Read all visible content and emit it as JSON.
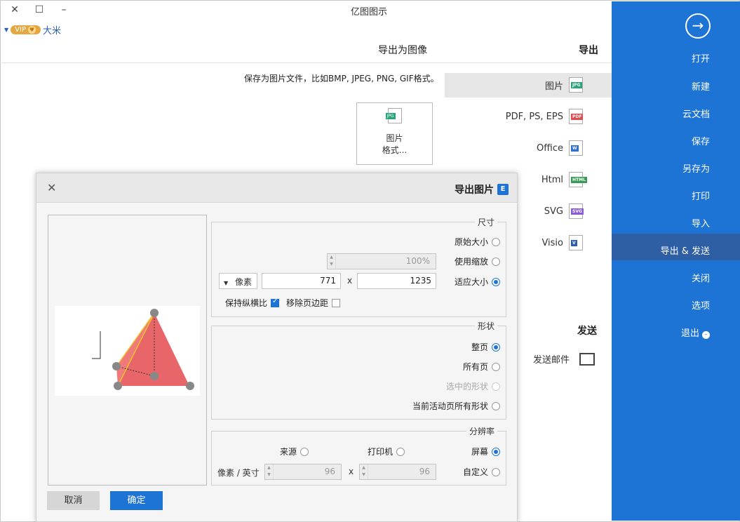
{
  "window": {
    "title": "亿图图示",
    "controls": {
      "close": "✕",
      "maximize": "☐",
      "minimize": "–"
    }
  },
  "user": {
    "vip_label": "VIP",
    "name": "大米"
  },
  "sidebar": {
    "back_icon": "→",
    "items": [
      {
        "label": "打开"
      },
      {
        "label": "新建"
      },
      {
        "label": "云文档"
      },
      {
        "label": "保存"
      },
      {
        "label": "另存为"
      },
      {
        "label": "打印"
      },
      {
        "label": "导入"
      },
      {
        "label": "导出 & 发送",
        "active": true
      },
      {
        "label": "关闭"
      },
      {
        "label": "选项"
      },
      {
        "label": "退出"
      }
    ]
  },
  "export_panel": {
    "heading": "导出",
    "items": [
      {
        "label": "图片",
        "icon_tag": "JPG",
        "icon_color": "#29a37a",
        "selected": true
      },
      {
        "label": "PDF, PS, EPS",
        "icon_tag": "PDF",
        "icon_color": "#e04d4d"
      },
      {
        "label": "Office",
        "icon_tag": "W",
        "icon_color": "#2b6fd6"
      },
      {
        "label": "Html",
        "icon_tag": "HTML",
        "icon_color": "#3a9a55"
      },
      {
        "label": "SVG",
        "icon_tag": "SVG",
        "icon_color": "#8a5bd6"
      },
      {
        "label": "Visio",
        "icon_tag": "V",
        "icon_color": "#2b5fb4"
      }
    ],
    "send_heading": "发送",
    "send_mail": "发送邮件"
  },
  "content": {
    "save_as_heading": "导出为图像",
    "description": "保存为图片文件，比如BMP, JPEG, PNG, GIF格式。",
    "card_tag": "JPG",
    "card_line1": "图片",
    "card_line2": "格式..."
  },
  "dialog": {
    "title": "导出图片",
    "logo": "E",
    "close": "✕",
    "size_group": {
      "title": "尺寸",
      "original": "原始大小",
      "use_zoom": "使用缩放",
      "zoom_value": "100%",
      "fit": "适应大小",
      "width": "1235",
      "height": "771",
      "x": "x",
      "unit": "像素",
      "remove_margin": "移除页边距",
      "keep_ratio": "保持纵横比"
    },
    "shape_group": {
      "title": "形状",
      "whole_page": "整页",
      "all_pages": "所有页",
      "selected_shapes": "选中的形状",
      "current_page_all_shapes": "当前活动页所有形状"
    },
    "resolution_group": {
      "title": "分辨率",
      "screen": "屏幕",
      "printer": "打印机",
      "source": "来源",
      "custom": "自定义",
      "dpi_x": "96",
      "dpi_y": "96",
      "unit": "像素 / 英寸",
      "x": "x"
    },
    "ok": "确定",
    "cancel": "取消"
  },
  "colors": {
    "accent": "#1e74d4",
    "sidebar_active": "#2e5fa4",
    "pyramid": "#e8666a"
  }
}
